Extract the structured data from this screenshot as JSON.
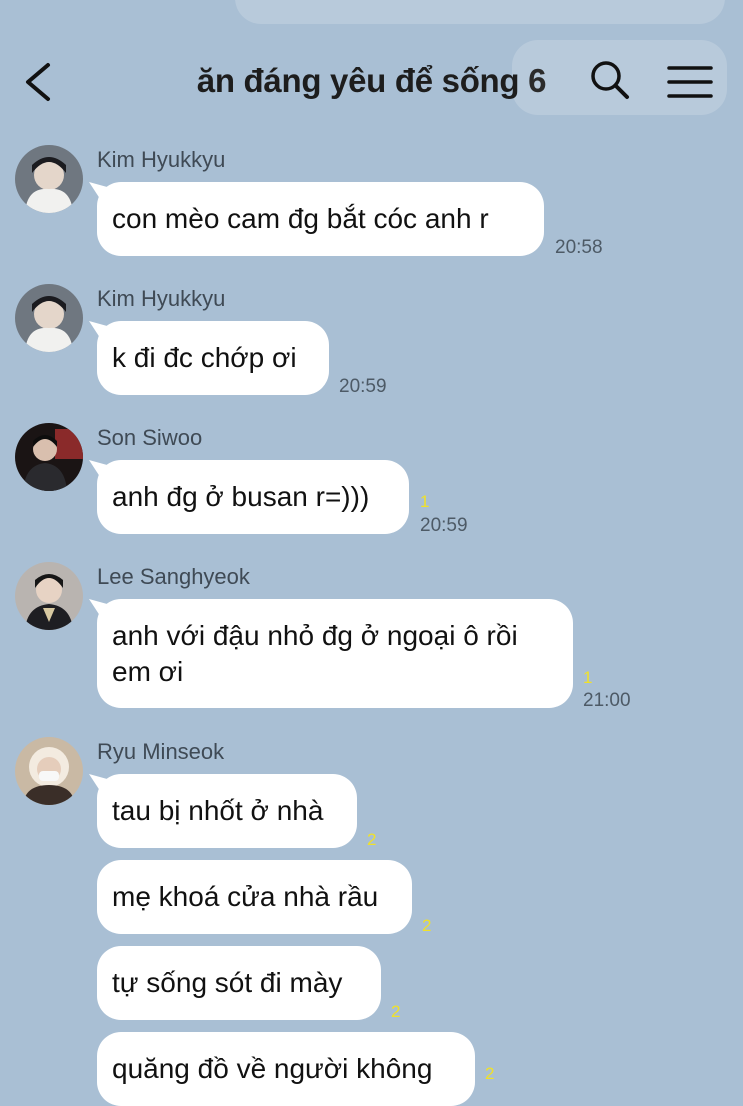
{
  "header": {
    "title": "ăn đáng yêu để sống",
    "member_count": "6"
  },
  "messages": [
    {
      "sender": "Kim Hyukkyu",
      "text": "con mèo cam đg bắt cóc anh r",
      "time": "20:58",
      "unread": ""
    },
    {
      "sender": "Kim Hyukkyu",
      "text": "k đi đc chớp ơi",
      "time": "20:59",
      "unread": ""
    },
    {
      "sender": "Son Siwoo",
      "text": "anh đg ở busan r=)))",
      "time": "20:59",
      "unread": "1"
    },
    {
      "sender": "Lee Sanghyeok",
      "text": "anh với đậu nhỏ đg ở ngoại ô rồi em ơi",
      "time": "21:00",
      "unread": "1"
    },
    {
      "sender": "Ryu Minseok",
      "text": "tau bị nhốt ở nhà",
      "time": "",
      "unread": "2"
    },
    {
      "sender": "",
      "text": "mẹ khoá cửa nhà rầu",
      "time": "",
      "unread": "2"
    },
    {
      "sender": "",
      "text": "tự sống sót đi mày",
      "time": "",
      "unread": "2"
    },
    {
      "sender": "",
      "text": "quăng đồ về người không",
      "time": "",
      "unread": "2"
    }
  ],
  "colors": {
    "background": "#a9bfd4",
    "bubble": "#ffffff",
    "unread": "#f0e12a"
  },
  "icons": [
    "chevron-left-icon",
    "search-icon",
    "hamburger-menu-icon"
  ]
}
